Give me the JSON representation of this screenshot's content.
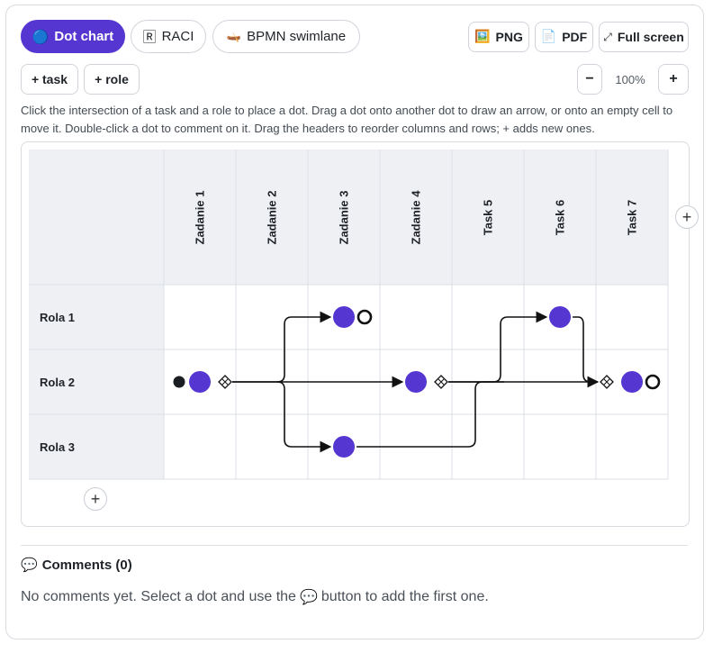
{
  "tabs": [
    {
      "label": "Dot chart",
      "icon": "🔵"
    },
    {
      "label": "RACI",
      "icon": "🅁"
    },
    {
      "label": "BPMN swimlane",
      "icon": "🛶"
    }
  ],
  "export": {
    "png": {
      "label": "PNG",
      "icon": "🖼️"
    },
    "pdf": {
      "label": "PDF",
      "icon": "📄"
    },
    "fullscreen": {
      "label": "Full screen",
      "icon": "⤢"
    }
  },
  "toolbar": {
    "add_task": "+ task",
    "add_role": "+ role",
    "zoom_out": "−",
    "zoom_in": "+",
    "zoom": "100%"
  },
  "help_text": "Click the intersection of a task and a role to place a dot. Drag a dot onto another dot to draw an arrow, or onto an empty cell to move it. Double-click a dot to comment on it. Drag the headers to reorder columns and rows; + adds new ones.",
  "columns": [
    "Zadanie 1",
    "Zadanie 2",
    "Zadanie 3",
    "Zadanie 4",
    "Task 5",
    "Task 6",
    "Task 7"
  ],
  "rows": [
    "Rola 1",
    "Rola 2",
    "Rola 3"
  ],
  "add_column": "+",
  "add_row": "+",
  "colors": {
    "accent": "#5636d1",
    "dot": "#5636d1",
    "header_bg": "#eef0f4",
    "grid": "#dcdfe4"
  },
  "comments": {
    "title": "Comments (0)",
    "icon": "💬",
    "empty_before": "No comments yet. Select a dot and use the",
    "empty_icon": "💬",
    "empty_after": "button to add the first one."
  }
}
